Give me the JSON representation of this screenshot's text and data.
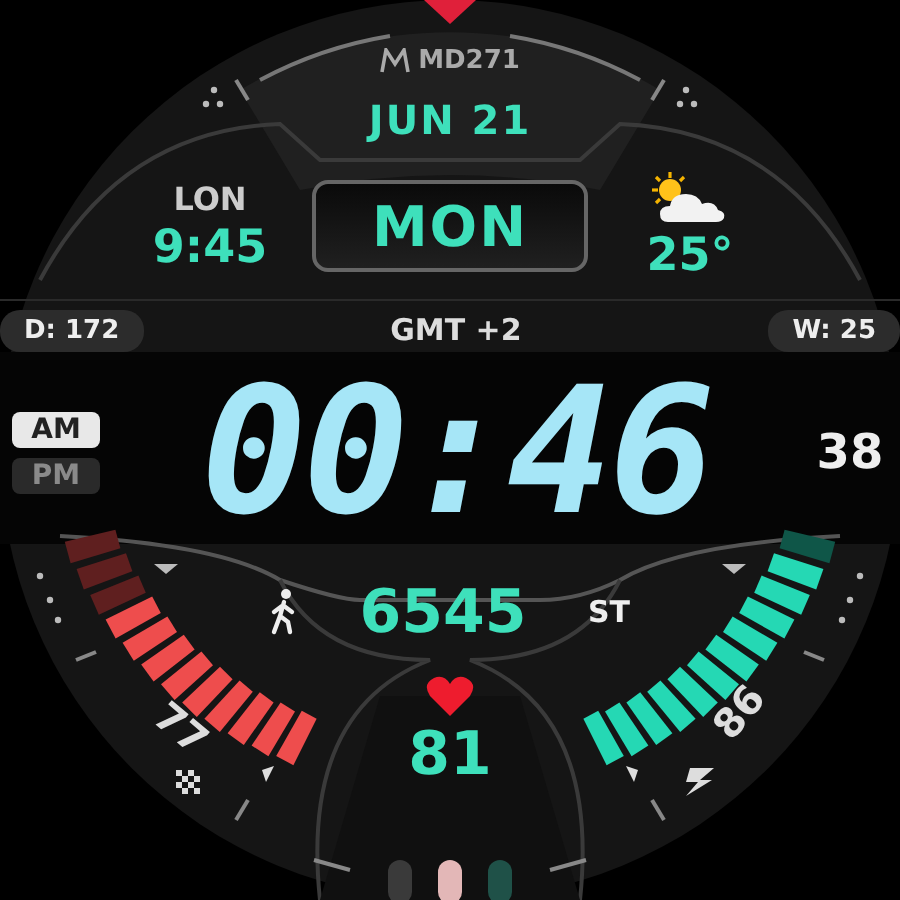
{
  "brand": "MD271",
  "date": "JUN 21",
  "world_clock": {
    "city": "LON",
    "time": "9:45"
  },
  "day": "MON",
  "weather": {
    "temperature": "25°"
  },
  "day_of_year": "D: 172",
  "timezone": "GMT +2",
  "week": "W: 25",
  "meridiem": [
    {
      "label": "AM",
      "selected": true
    },
    {
      "label": "PM",
      "selected": false
    }
  ],
  "time": "00:46",
  "seconds": "38",
  "steps": {
    "value": "6545",
    "label": "ST"
  },
  "gauges": [
    {
      "value": "77",
      "color": "#ee4d4d"
    },
    {
      "value": "86",
      "color": "#25d8b4"
    }
  ],
  "heart_rate": "81"
}
